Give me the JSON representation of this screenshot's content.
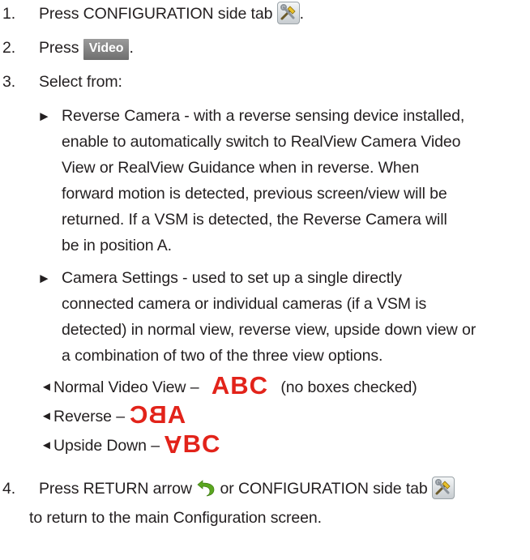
{
  "steps": [
    {
      "num": "1.",
      "text": "Press CONFIGURATION side tab",
      "after": "."
    },
    {
      "num": "2.",
      "text": "Press",
      "button": "Video",
      "after": "."
    },
    {
      "num": "3.",
      "text": "Select from:"
    },
    {
      "num": "4.",
      "text_a": "Press RETURN arrow",
      "text_b": "or CONFIGURATION side tab",
      "line2": "to return to the main Configuration screen."
    }
  ],
  "bullets": [
    {
      "marker": "►",
      "lines": [
        "Reverse Camera - with a reverse sensing device installed,",
        "enable to automatically switch to RealView Camera Video",
        "View or RealView Guidance when in reverse. When",
        "forward motion is detected, previous screen/view will be",
        "returned. If a VSM is detected, the Reverse Camera will",
        "be in position A."
      ]
    },
    {
      "marker": "►",
      "lines": [
        "Camera Settings - used to set up a single directly",
        "connected camera or individual cameras (if a VSM is",
        "detected) in normal view, reverse view, upside down view or",
        "a combination of two of the three view options."
      ]
    }
  ],
  "views": [
    {
      "marker": "◄",
      "label": "Normal Video View –",
      "sample": "ABC",
      "note": "(no boxes checked)"
    },
    {
      "marker": "◄",
      "label": "Reverse –",
      "sample": "ABC"
    },
    {
      "marker": "◄",
      "label": "Upside Down –",
      "sample_flipped": "A",
      "sample_rest": "BC"
    }
  ],
  "icons": {
    "config_tab": "wrench-screwdriver-icon",
    "return_arrow": "return-arrow-icon"
  },
  "colors": {
    "sample_red": "#e2231a",
    "video_button": "#7f7f7f",
    "return_green": "#5aa61f"
  }
}
